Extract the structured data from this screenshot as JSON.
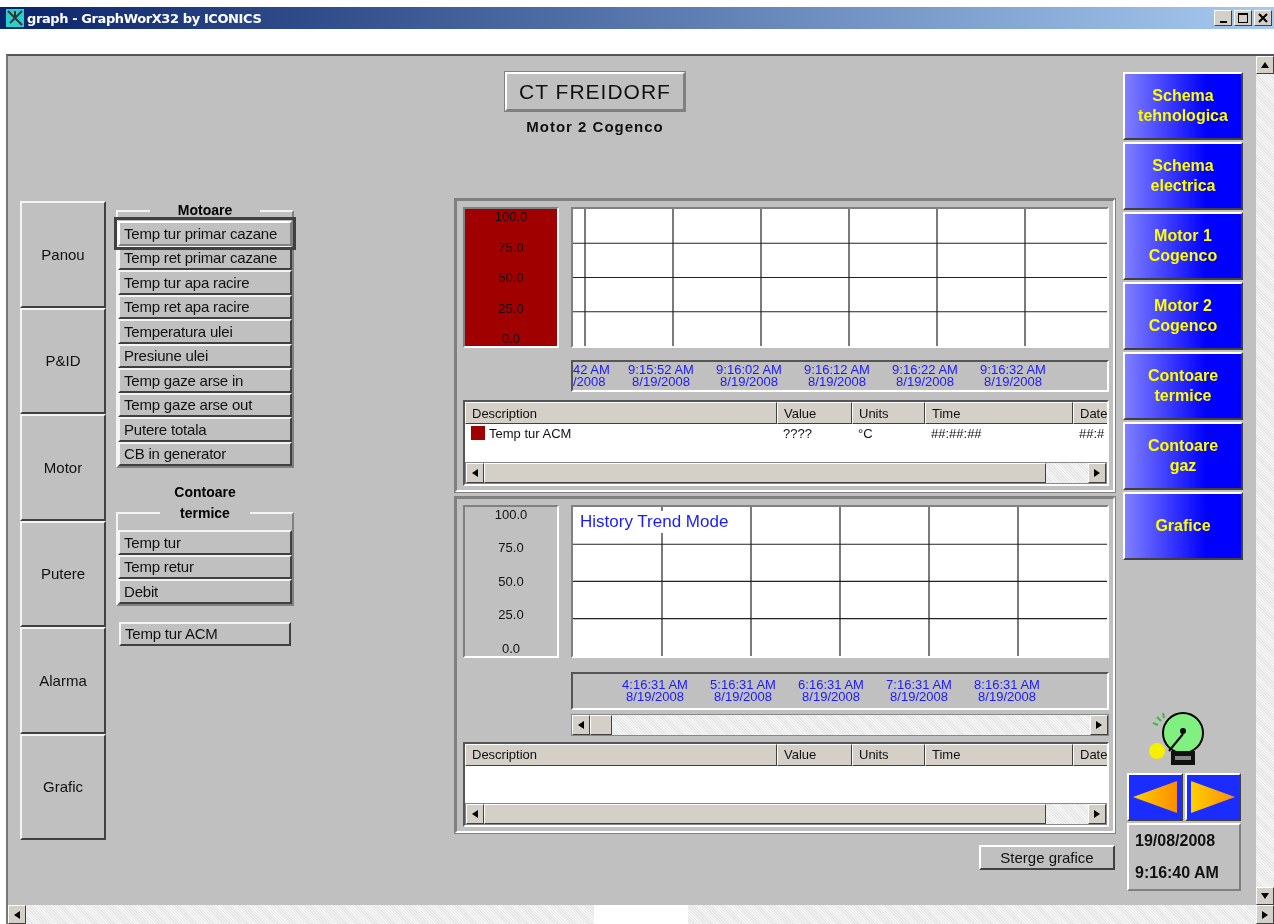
{
  "window": {
    "title": "graph - GraphWorX32 by ICONICS"
  },
  "header": {
    "title": "CT FREIDORF",
    "subtitle": "Motor 2 Cogenco"
  },
  "nav": [
    "Panou",
    "P&ID",
    "Motor",
    "Putere",
    "Alarma",
    "Grafic"
  ],
  "groups": [
    {
      "title": "Motoare",
      "items": [
        {
          "label": "Temp tur primar cazane",
          "selected": true
        },
        {
          "label": "Temp ret primar cazane",
          "selected": false
        },
        {
          "label": "Temp tur apa racire",
          "selected": false
        },
        {
          "label": "Temp ret apa racire",
          "selected": false
        },
        {
          "label": "Temperatura ulei",
          "selected": false
        },
        {
          "label": "Presiune ulei",
          "selected": false
        },
        {
          "label": "Temp gaze arse in",
          "selected": false
        },
        {
          "label": "Temp gaze arse out",
          "selected": false
        },
        {
          "label": "Putere totala",
          "selected": false
        },
        {
          "label": "CB in generator",
          "selected": false
        }
      ]
    },
    {
      "title": "Contoare termice",
      "items": [
        {
          "label": "Temp tur",
          "selected": false
        },
        {
          "label": "Temp retur",
          "selected": false
        },
        {
          "label": "Debit",
          "selected": false
        }
      ]
    }
  ],
  "extra_button": "Temp tur ACM",
  "trends": [
    {
      "y_labels": [
        "100.0",
        "75.0",
        "50.0",
        "25.0",
        "0.0"
      ],
      "x_labels": [
        {
          "time": "42 AM",
          "date": "/2008"
        },
        {
          "time": "9:15:52 AM",
          "date": "8/19/2008"
        },
        {
          "time": "9:16:02 AM",
          "date": "8/19/2008"
        },
        {
          "time": "9:16:12 AM",
          "date": "8/19/2008"
        },
        {
          "time": "9:16:22 AM",
          "date": "8/19/2008"
        },
        {
          "time": "9:16:32 AM",
          "date": "8/19/2008"
        }
      ],
      "columns": [
        "Description",
        "Value",
        "Units",
        "Time",
        "Date"
      ],
      "rows": [
        {
          "color": "#a00000",
          "description": "Temp tur ACM",
          "value": "????",
          "units": "°C",
          "time": "##:##:##",
          "date": "##:#"
        }
      ]
    },
    {
      "mode": "History Trend Mode",
      "y_labels": [
        "100.0",
        "75.0",
        "50.0",
        "25.0",
        "0.0"
      ],
      "x_labels": [
        {
          "time": "4:16:31 AM",
          "date": "8/19/2008"
        },
        {
          "time": "5:16:31 AM",
          "date": "8/19/2008"
        },
        {
          "time": "6:16:31 AM",
          "date": "8/19/2008"
        },
        {
          "time": "7:16:31 AM",
          "date": "8/19/2008"
        },
        {
          "time": "8:16:31 AM",
          "date": "8/19/2008"
        }
      ],
      "columns": [
        "Description",
        "Value",
        "Units",
        "Time",
        "Date"
      ]
    }
  ],
  "clear_button": "Sterge grafice",
  "screens": [
    "Schema\ntehnologica",
    "Schema\nelectrica",
    "Motor 1\nCogenco",
    "Motor 2\nCogenco",
    "Contoare\ntermice",
    "Contoare\ngaz",
    "Grafice"
  ],
  "date": "19/08/2008",
  "time": "9:16:40 AM"
}
